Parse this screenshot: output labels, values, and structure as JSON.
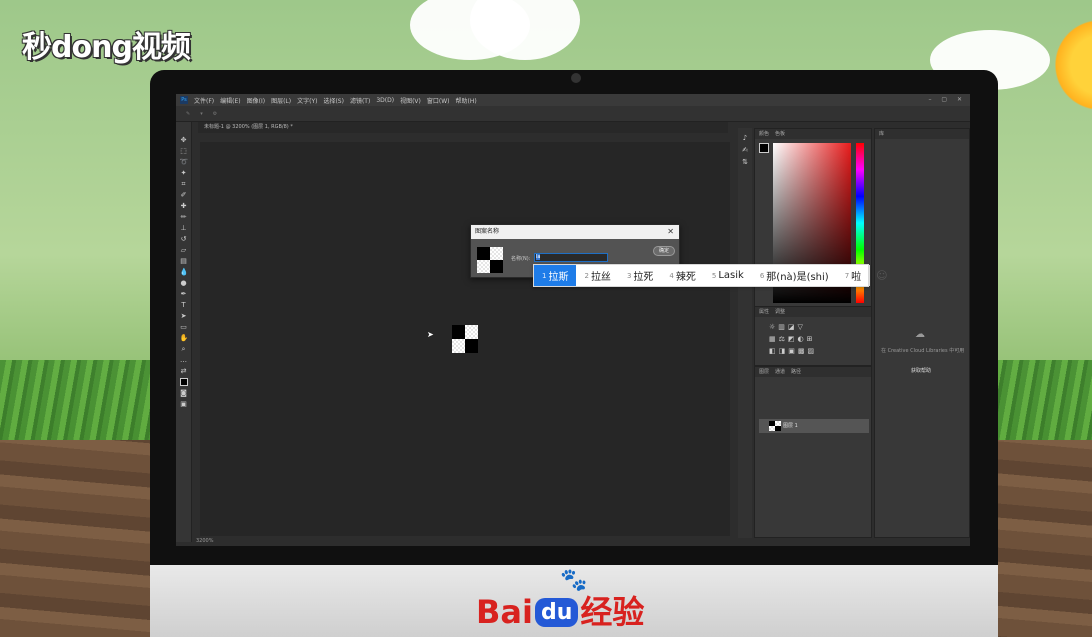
{
  "watermark": {
    "text": "秒dong视频"
  },
  "photoshop": {
    "menus": [
      "文件(F)",
      "编辑(E)",
      "图像(I)",
      "图层(L)",
      "文字(Y)",
      "选择(S)",
      "滤镜(T)",
      "3D(D)",
      "视图(V)",
      "窗口(W)",
      "帮助(H)"
    ],
    "window_controls": "– ▢ ✕",
    "document_tab": "未标题-1 @ 3200% (图层 1, RGB/8) *",
    "status": "3200%",
    "color_panel": {
      "tabs": [
        "颜色",
        "色板"
      ]
    },
    "adjust_panel": {
      "tabs": [
        "属性",
        "调整"
      ]
    },
    "layers_panel": {
      "tabs": [
        "图层",
        "通道",
        "路径"
      ],
      "layer_name": "图层 1"
    },
    "libraries_panel": {
      "tab": "库",
      "text": "在 Creative Cloud Libraries 中可用",
      "link": "获取帮助"
    }
  },
  "dialog": {
    "title": "图案名称",
    "name_label": "名称(N):",
    "name_value": "la",
    "ok_label": "确定"
  },
  "ime": {
    "candidates": [
      {
        "num": "1",
        "text": "拉斯",
        "selected": true
      },
      {
        "num": "2",
        "text": "拉丝",
        "selected": false
      },
      {
        "num": "3",
        "text": "拉死",
        "selected": false
      },
      {
        "num": "4",
        "text": "辣死",
        "selected": false
      },
      {
        "num": "5",
        "text": "Lasik",
        "selected": false
      },
      {
        "num": "6",
        "text": "那(nà)是(shi)",
        "selected": false
      },
      {
        "num": "7",
        "text": "啦",
        "selected": false
      }
    ],
    "emoji_icon": "☺"
  },
  "brand": {
    "text_left": "Bai",
    "text_du": "du",
    "text_right": "经验"
  },
  "colors": {
    "accent": "#1e7ce8",
    "baidu_red": "#d8221f",
    "baidu_blue": "#2459d6"
  }
}
